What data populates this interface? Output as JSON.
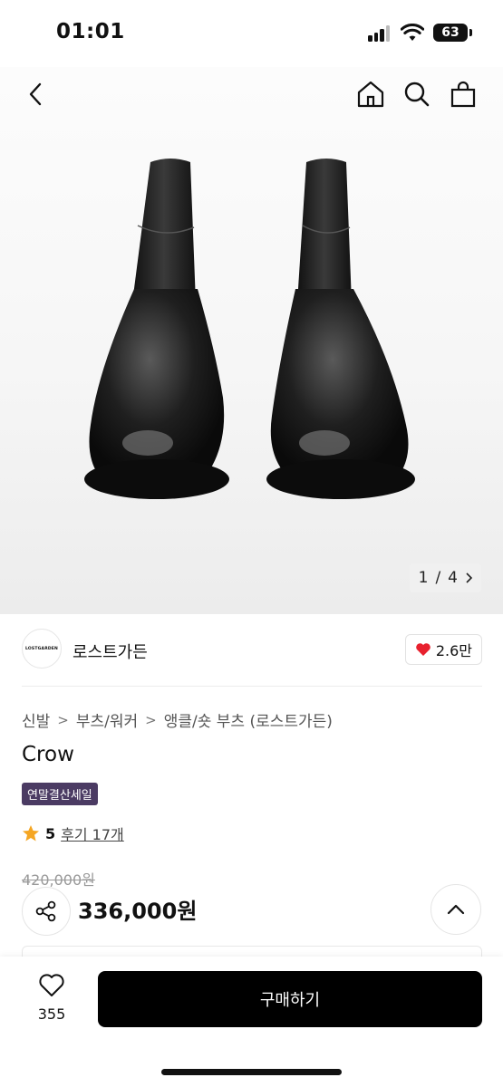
{
  "status_bar": {
    "time": "01:01",
    "battery": "63"
  },
  "gallery": {
    "current": "1",
    "total": "4",
    "separator": "/"
  },
  "seller": {
    "logo_text": "LOSTGARDEN",
    "name": "로스트가든",
    "likes": "2.6만"
  },
  "breadcrumb": [
    "신발",
    "부츠/워커",
    "앵클/숏 부츠 (로스트가든)"
  ],
  "product": {
    "title": "Crow",
    "badge": "연말결산세일",
    "rating": "5",
    "reviews": "후기 17개",
    "original_price": "420,000원",
    "price": "336,000원"
  },
  "bottom": {
    "wish_count": "355",
    "buy_label": "구매하기"
  },
  "icons": [
    "back-icon",
    "home-icon",
    "search-icon",
    "bag-icon",
    "heart-icon",
    "star-icon",
    "share-icon",
    "chevron-up-icon",
    "heart-outline-icon"
  ],
  "colors": {
    "badge": "#4b3b63",
    "heart": "#e8212e",
    "star": "#f5a623",
    "buy_button": "#000000"
  }
}
